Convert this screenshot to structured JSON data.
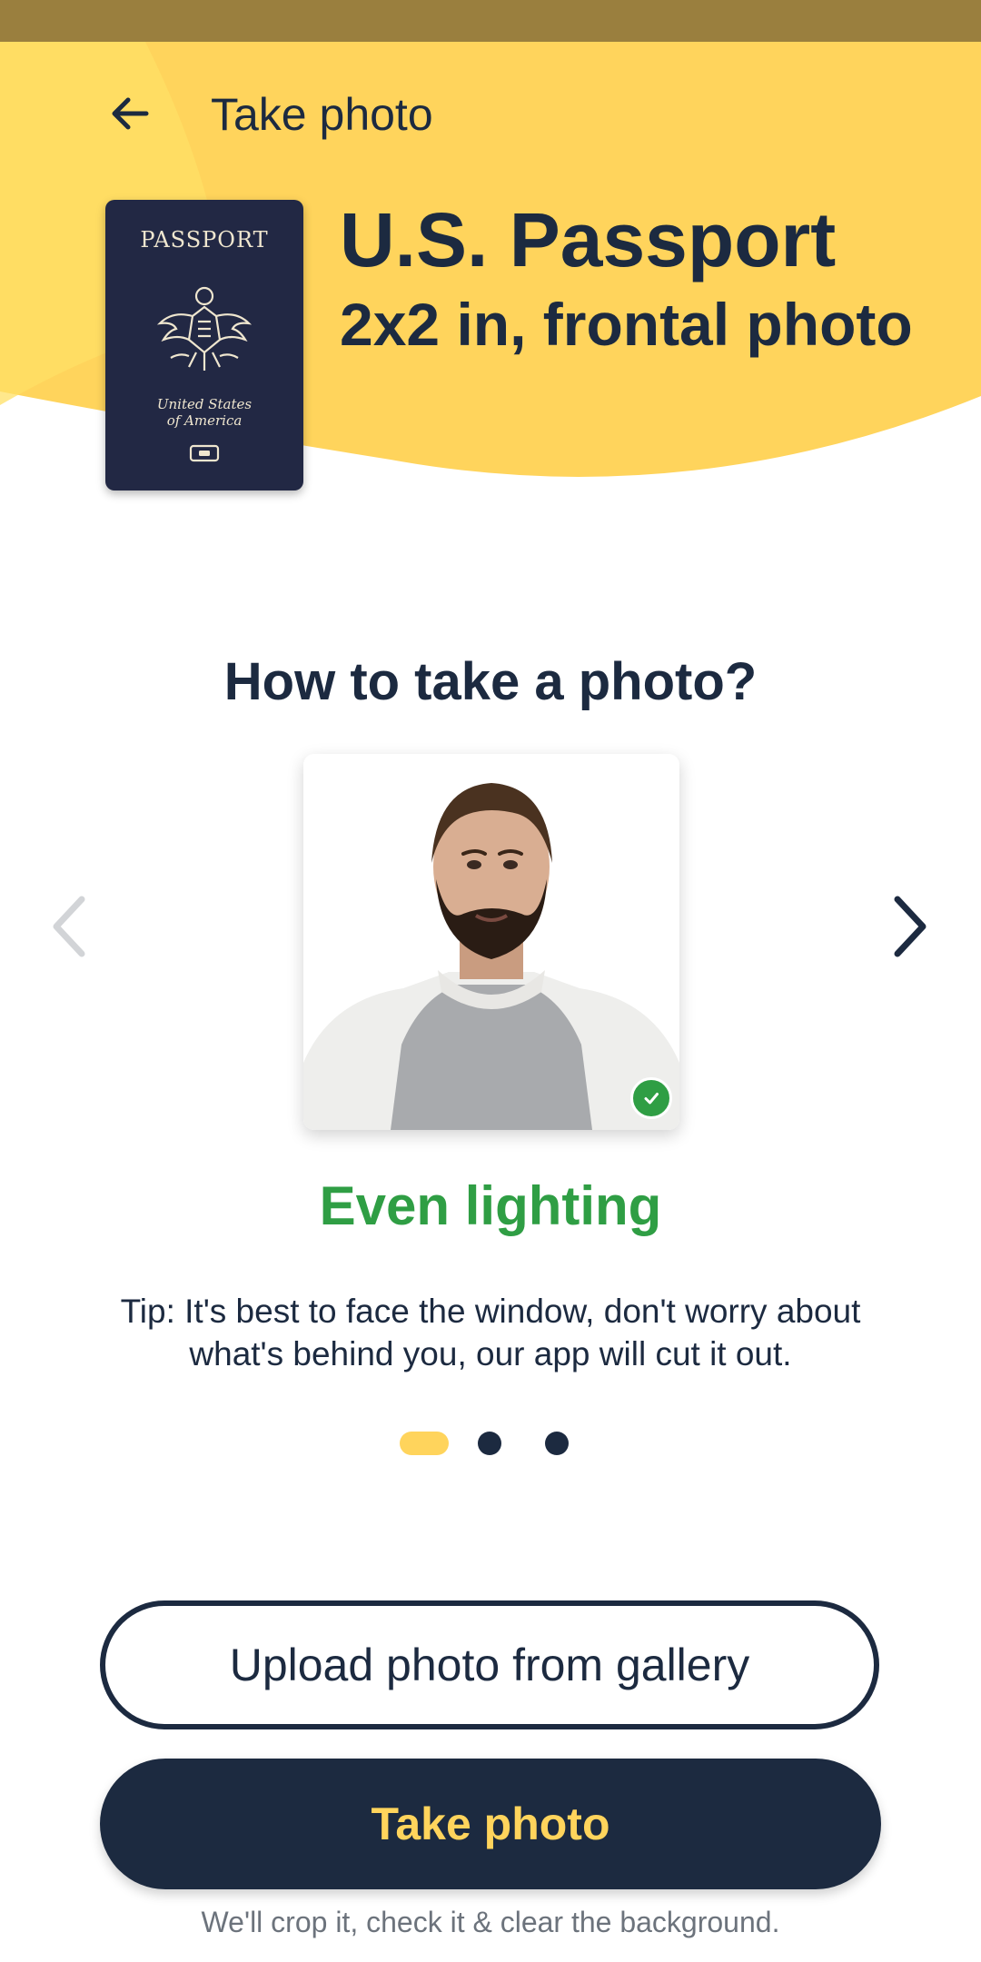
{
  "colors": {
    "accent_yellow": "#ffd45c",
    "navy": "#1c2a40",
    "success_green": "#2f9e44",
    "status_bar": "#9a7f3e"
  },
  "header": {
    "back_icon": "arrow-left-icon",
    "title": "Take photo"
  },
  "document": {
    "cover_title": "PASSPORT",
    "cover_subtitle_line1": "United States",
    "cover_subtitle_line2": "of America",
    "title": "U.S. Passport",
    "subtitle": "2x2 in, frontal photo"
  },
  "howto": {
    "title": "How to take a photo?",
    "prev_icon": "chevron-left-icon",
    "next_icon": "chevron-right-icon",
    "current_slide": 1,
    "total_slides": 3,
    "slide": {
      "status_icon": "check-circle-icon",
      "title": "Even lighting",
      "tip": "Tip: It's best to face the window, don't worry about what's behind you, our app will cut it out."
    }
  },
  "actions": {
    "upload_label": "Upload photo from gallery",
    "take_photo_label": "Take photo",
    "footnote": "We'll crop it, check it & clear the background."
  }
}
